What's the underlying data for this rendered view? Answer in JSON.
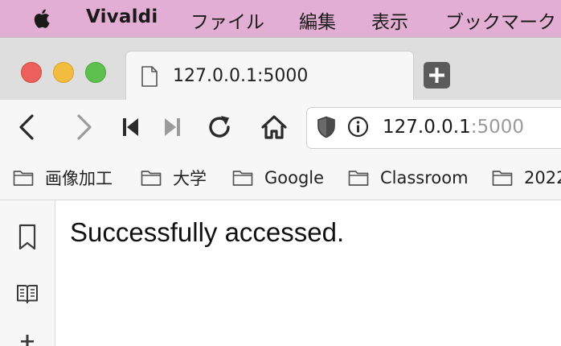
{
  "menubar": {
    "app_name": "Vivaldi",
    "items": [
      "ファイル",
      "編集",
      "表示",
      "ブックマーク"
    ]
  },
  "tab": {
    "title": "127.0.0.1:5000"
  },
  "address": {
    "host": "127.0.0.1",
    "port": ":5000"
  },
  "bookmarks": [
    "画像加工",
    "大学",
    "Google",
    "Classroom",
    "2022"
  ],
  "page": {
    "message": "Successfully accessed."
  },
  "icons": {
    "apple": "apple-logo-icon",
    "document": "document-icon",
    "new_tab": "plus-icon",
    "back": "back-arrow-icon",
    "forward": "forward-arrow-icon",
    "rewind": "rewind-icon",
    "fast_forward": "fast-forward-icon",
    "reload": "reload-icon",
    "home": "home-icon",
    "shield": "shield-icon",
    "info": "info-icon",
    "folder": "folder-icon",
    "bookmark_panel": "bookmark-icon",
    "reading_list": "book-icon",
    "downloads": "download-icon"
  },
  "colors": {
    "menubar_bg": "#e3aed3",
    "traffic_red": "#ec5f5a",
    "traffic_yellow": "#f2bd3f",
    "traffic_green": "#5ec04f"
  }
}
